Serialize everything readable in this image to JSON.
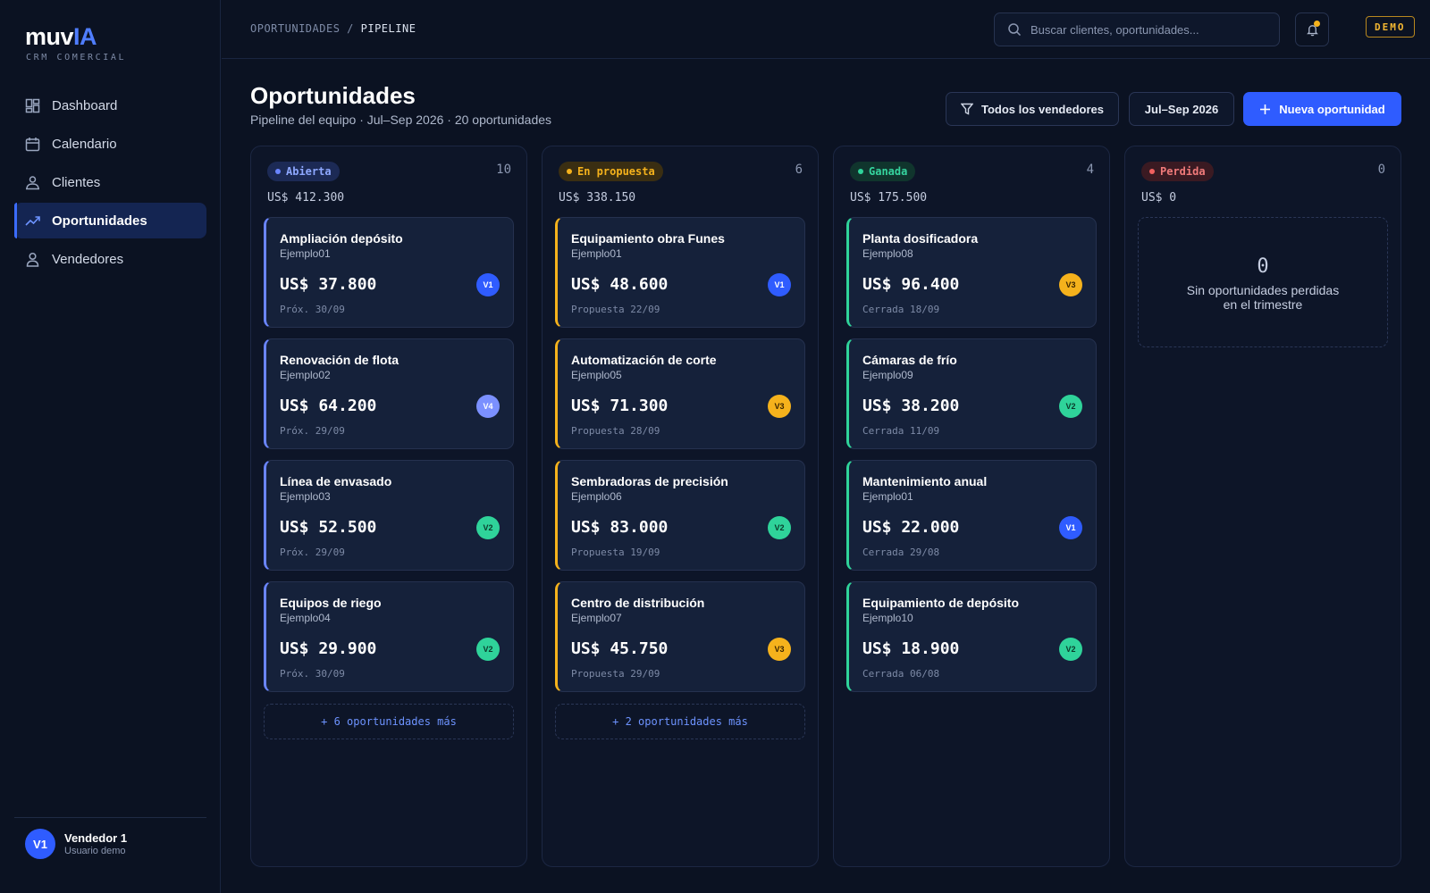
{
  "brand": {
    "name_a": "muv",
    "name_b": "IA",
    "subtitle": "CRM COMERCIAL"
  },
  "nav": [
    {
      "label": "Dashboard",
      "icon": "dashboard-icon",
      "active": false
    },
    {
      "label": "Calendario",
      "icon": "calendar-icon",
      "active": false
    },
    {
      "label": "Clientes",
      "icon": "clients-icon",
      "active": false
    },
    {
      "label": "Oportunidades",
      "icon": "trend-icon",
      "active": true
    },
    {
      "label": "Vendedores",
      "icon": "user-icon",
      "active": false
    }
  ],
  "user": {
    "initials": "V1",
    "name": "Vendedor 1",
    "role": "Usuario demo"
  },
  "breadcrumb": {
    "parent": "OPORTUNIDADES",
    "separator": "/",
    "current": "PIPELINE"
  },
  "search": {
    "placeholder": "Buscar clientes, oportunidades..."
  },
  "badge": "DEMO",
  "header": {
    "title": "Oportunidades",
    "subtitle": "Pipeline del equipo · Jul–Sep 2026 · 20 oportunidades",
    "filter_label": "Todos los vendedores",
    "period_label": "Jul–Sep 2026",
    "new_label": "Nueva oportunidad"
  },
  "colors": {
    "accent": "#2f5cff",
    "open": "#6a85ff",
    "proposal": "#f5b21c",
    "won": "#2fd39a",
    "lost": "#f0605f"
  },
  "columns": [
    {
      "label": "Abierta",
      "count": "10",
      "total": "US$ 412.300",
      "status": "open",
      "cards": [
        {
          "title": "Ampliación depósito",
          "client": "Ejemplo01",
          "amount": "US$ 37.800",
          "date": "Próx. 30/09",
          "avatar": "V1"
        },
        {
          "title": "Renovación de flota",
          "client": "Ejemplo02",
          "amount": "US$ 64.200",
          "date": "Próx. 29/09",
          "avatar": "V4"
        },
        {
          "title": "Línea de envasado",
          "client": "Ejemplo03",
          "amount": "US$ 52.500",
          "date": "Próx. 29/09",
          "avatar": "V2"
        },
        {
          "title": "Equipos de riego",
          "client": "Ejemplo04",
          "amount": "US$ 29.900",
          "date": "Próx. 30/09",
          "avatar": "V2"
        }
      ],
      "more": "+ 6 oportunidades más"
    },
    {
      "label": "En propuesta",
      "count": "6",
      "total": "US$ 338.150",
      "status": "proposal",
      "cards": [
        {
          "title": "Equipamiento obra Funes",
          "client": "Ejemplo01",
          "amount": "US$ 48.600",
          "date": "Propuesta 22/09",
          "avatar": "V1"
        },
        {
          "title": "Automatización de corte",
          "client": "Ejemplo05",
          "amount": "US$ 71.300",
          "date": "Propuesta 28/09",
          "avatar": "V3"
        },
        {
          "title": "Sembradoras de precisión",
          "client": "Ejemplo06",
          "amount": "US$ 83.000",
          "date": "Propuesta 19/09",
          "avatar": "V2"
        },
        {
          "title": "Centro de distribución",
          "client": "Ejemplo07",
          "amount": "US$ 45.750",
          "date": "Propuesta 29/09",
          "avatar": "V3"
        }
      ],
      "more": "+ 2 oportunidades más"
    },
    {
      "label": "Ganada",
      "count": "4",
      "total": "US$ 175.500",
      "status": "won",
      "cards": [
        {
          "title": "Planta dosificadora",
          "client": "Ejemplo08",
          "amount": "US$ 96.400",
          "date": "Cerrada 18/09",
          "avatar": "V3"
        },
        {
          "title": "Cámaras de frío",
          "client": "Ejemplo09",
          "amount": "US$ 38.200",
          "date": "Cerrada 11/09",
          "avatar": "V2"
        },
        {
          "title": "Mantenimiento anual",
          "client": "Ejemplo01",
          "amount": "US$ 22.000",
          "date": "Cerrada 29/08",
          "avatar": "V1"
        },
        {
          "title": "Equipamiento de depósito",
          "client": "Ejemplo10",
          "amount": "US$ 18.900",
          "date": "Cerrada 06/08",
          "avatar": "V2"
        }
      ],
      "more": ""
    },
    {
      "label": "Perdida",
      "count": "0",
      "total": "US$ 0",
      "status": "lost",
      "cards": [],
      "more": "",
      "empty_count": "0",
      "empty_text": "Sin oportunidades perdidas en el trimestre"
    }
  ]
}
